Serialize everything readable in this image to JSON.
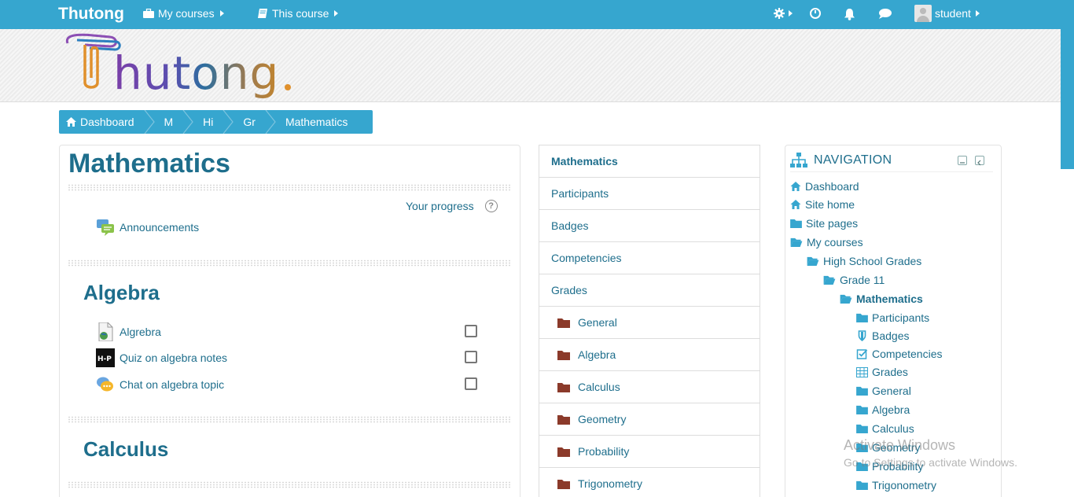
{
  "navbar": {
    "brand": "Thutong",
    "my_courses": "My courses",
    "this_course": "This course",
    "user_name": "student"
  },
  "logo_text": "Thutong.",
  "breadcrumb": [
    "Dashboard",
    "M",
    "Hi",
    "Gr",
    "Mathematics"
  ],
  "main": {
    "title": "Mathematics",
    "progress_label": "Your progress",
    "announcements": "Announcements",
    "sections": [
      {
        "title": "Algebra",
        "activities": [
          {
            "label": "Algrebra",
            "icon": "page-icon"
          },
          {
            "label": "Quiz on algebra notes",
            "icon": "h5p-icon"
          },
          {
            "label": "Chat on algebra topic",
            "icon": "chat-icon"
          }
        ]
      },
      {
        "title": "Calculus",
        "activities": []
      }
    ]
  },
  "course_menu": [
    {
      "label": "Mathematics",
      "bold": true,
      "folder": false
    },
    {
      "label": "Participants",
      "folder": false
    },
    {
      "label": "Badges",
      "folder": false
    },
    {
      "label": "Competencies",
      "folder": false
    },
    {
      "label": "Grades",
      "folder": false
    },
    {
      "label": "General",
      "folder": true
    },
    {
      "label": "Algebra",
      "folder": true
    },
    {
      "label": "Calculus",
      "folder": true
    },
    {
      "label": "Geometry",
      "folder": true
    },
    {
      "label": "Probability",
      "folder": true
    },
    {
      "label": "Trigonometry",
      "folder": true
    }
  ],
  "navigation": {
    "heading": "NAVIGATION",
    "items": [
      {
        "label": "Dashboard",
        "icon": "home-icon"
      },
      {
        "label": "Site home",
        "icon": "home-icon"
      },
      {
        "label": "Site pages",
        "icon": "folder-icon"
      },
      {
        "label": "My courses",
        "icon": "folder-open-icon"
      },
      {
        "label": "High School Grades",
        "icon": "folder-open-icon"
      },
      {
        "label": "Grade 11",
        "icon": "folder-open-icon"
      },
      {
        "label": "Mathematics",
        "icon": "folder-open-icon"
      },
      {
        "label": "Participants",
        "icon": "folder-icon"
      },
      {
        "label": "Badges",
        "icon": "shield-icon"
      },
      {
        "label": "Competencies",
        "icon": "checkbox-icon"
      },
      {
        "label": "Grades",
        "icon": "table-icon"
      },
      {
        "label": "General",
        "icon": "folder-icon"
      },
      {
        "label": "Algebra",
        "icon": "folder-icon"
      },
      {
        "label": "Calculus",
        "icon": "folder-icon"
      },
      {
        "label": "Geometry",
        "icon": "folder-icon"
      },
      {
        "label": "Probability",
        "icon": "folder-icon"
      },
      {
        "label": "Trigonometry",
        "icon": "folder-icon"
      }
    ]
  },
  "watermark": {
    "line1": "Activate Windows",
    "line2": "Go to Settings to activate Windows."
  },
  "colors": {
    "brand": "#36a6cf",
    "link": "#1e6e8c",
    "folder_brown": "#8b3a2a"
  }
}
